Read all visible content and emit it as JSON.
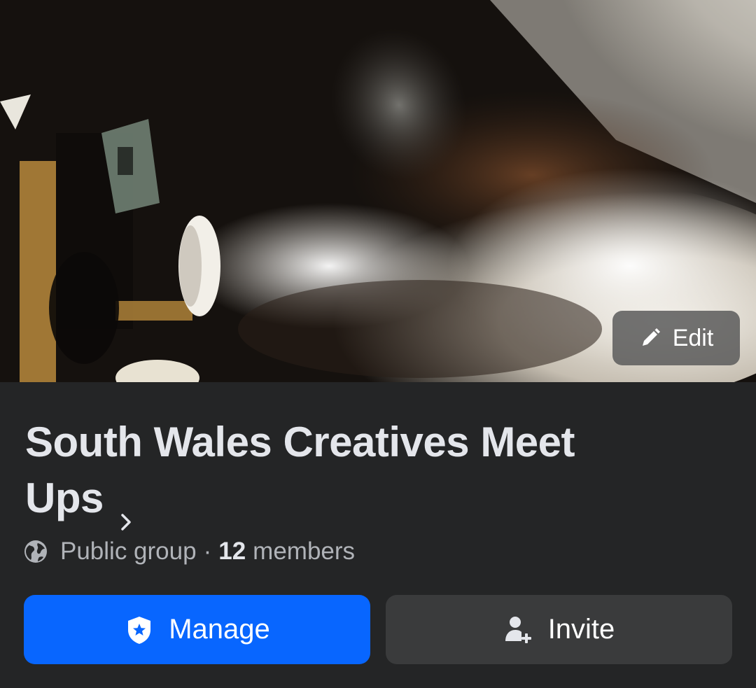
{
  "cover": {
    "description_icon": "smoke-projector-photo",
    "edit_label": "Edit"
  },
  "group": {
    "name": "South Wales Creatives Meet Ups",
    "privacy": "Public group",
    "separator": "·",
    "member_count": "12",
    "members_label": "members"
  },
  "actions": {
    "manage_label": "Manage",
    "invite_label": "Invite"
  },
  "colors": {
    "background": "#242526",
    "primary_button": "#0866ff",
    "secondary_button": "#3a3b3c",
    "text_primary": "#e4e6eb",
    "text_secondary": "#b0b3b8"
  },
  "icons": {
    "edit": "pencil-icon",
    "chevron": "chevron-right-icon",
    "privacy": "globe-icon",
    "manage": "shield-star-icon",
    "invite": "add-person-icon"
  }
}
